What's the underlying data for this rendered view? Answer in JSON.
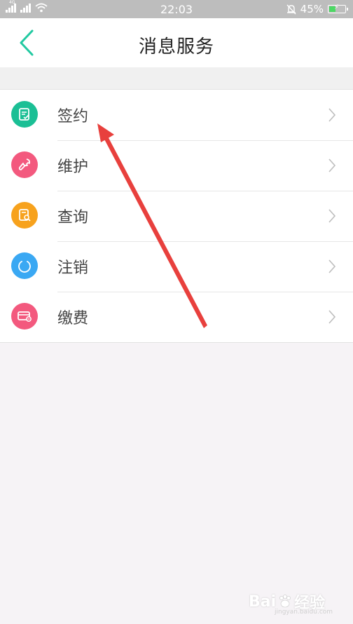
{
  "status_bar": {
    "time": "22:03",
    "battery": "45%",
    "battery_level": 0.45,
    "signal_tag": "4G"
  },
  "header": {
    "title": "消息服务"
  },
  "menu": [
    {
      "label": "签约",
      "icon": "contract-icon",
      "color": "#1bbf95"
    },
    {
      "label": "维护",
      "icon": "wrench-icon",
      "color": "#f3597e"
    },
    {
      "label": "查询",
      "icon": "search-doc-icon",
      "color": "#f7a21d"
    },
    {
      "label": "注销",
      "icon": "power-icon",
      "color": "#3aa8f3"
    },
    {
      "label": "缴费",
      "icon": "card-payment-icon",
      "color": "#f3597e"
    }
  ],
  "colors": {
    "accent": "#22c9a1",
    "annotation_arrow": "#e8403d"
  },
  "watermark": {
    "brand": "Bai",
    "brand_cn": "经验",
    "sub": "jingyan.baidu.com"
  }
}
